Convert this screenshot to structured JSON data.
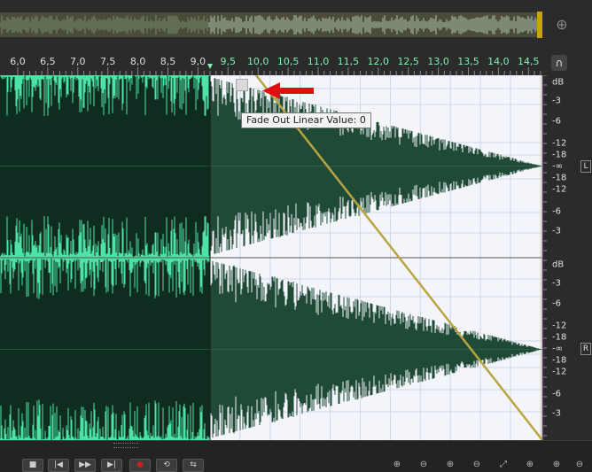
{
  "app": {
    "colors": {
      "selection_bg": "#4ee3a6",
      "selection_wave": "#0e2c1f",
      "unselected_bg": "#f3f5fb",
      "unselected_wave": "#1f4a36",
      "fade_line": "#b8a540",
      "playhead": "#c9a400",
      "arrow": "#e01010"
    }
  },
  "ruler": {
    "labels": [
      "6,0",
      "6,5",
      "7,0",
      "7,5",
      "8,0",
      "8,5",
      "9,0",
      "9,5",
      "10,0",
      "10,5",
      "11,0",
      "11,5",
      "12,0",
      "12,5",
      "13,0",
      "13,5",
      "14,0",
      "14,5"
    ],
    "selection_start_label": "9,0"
  },
  "db_scale": {
    "top": {
      "header": "dB",
      "labels": [
        "-3",
        "-6",
        "-12",
        "-18",
        "-∞",
        "-18",
        "-12",
        "-6",
        "-3"
      ],
      "channel": "L"
    },
    "bottom": {
      "header": "dB",
      "labels": [
        "-3",
        "-6",
        "-12",
        "-18",
        "-∞",
        "-18",
        "-12",
        "-6",
        "-3"
      ],
      "channel": "R"
    }
  },
  "tooltip": {
    "text": "Fade Out Linear Value: 0"
  },
  "icons": {
    "zoom": "zoom-icon",
    "snap": "magnet-icon",
    "transport": [
      "stop-icon",
      "rewind-start-icon",
      "rewind-icon",
      "fast-forward-icon",
      "skip-end-icon",
      "record-icon",
      "loop-icon",
      "skip-selection-icon"
    ],
    "zoom_controls": [
      "zoom-in-amplitude-icon",
      "zoom-out-amplitude-icon",
      "zoom-in-time-icon",
      "zoom-out-time-icon",
      "zoom-full-icon"
    ]
  }
}
